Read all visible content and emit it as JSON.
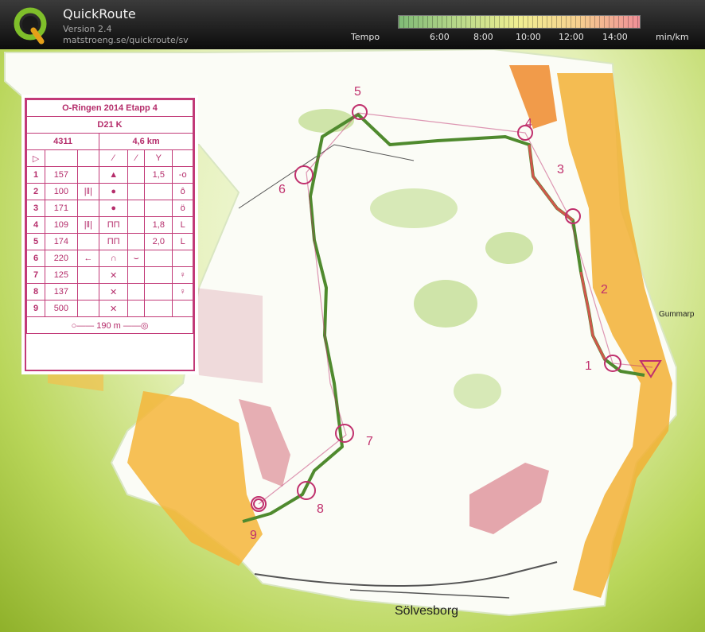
{
  "app": {
    "title": "QuickRoute",
    "version": "Version 2.4",
    "url": "matstroeng.se/quickroute/sv"
  },
  "tempo": {
    "label": "Tempo",
    "ticks": [
      "6:00",
      "8:00",
      "10:00",
      "12:00",
      "14:00"
    ],
    "unit": "min/km",
    "colors": [
      "#7fba76",
      "#f1ef92",
      "#ef8f97"
    ]
  },
  "map": {
    "town_label": "Sölvesborg",
    "place_label": "Gummarp",
    "control_numbers": [
      "1",
      "2",
      "3",
      "4",
      "5",
      "6",
      "7",
      "8",
      "9"
    ],
    "route_color": "#4f8a2e",
    "control_color": "#c0306d"
  },
  "card": {
    "title": "O-Ringen 2014 Etapp 4",
    "class": "D21 K",
    "code": "4311",
    "length": "4,6 km",
    "rows": [
      {
        "n": "1",
        "code": "157",
        "c3": "▲",
        "c4": "1,5",
        "c5": "-o"
      },
      {
        "n": "2",
        "code": "100",
        "c2": "|‖|",
        "c3": "●",
        "c4": "",
        "c5": "ô"
      },
      {
        "n": "3",
        "code": "171",
        "c3": "●",
        "c4": "",
        "c5": "ö"
      },
      {
        "n": "4",
        "code": "109",
        "c2": "|‖|",
        "c3": "ΠΠ",
        "c4": "1,8",
        "c5": "L"
      },
      {
        "n": "5",
        "code": "174",
        "c3": "ΠΠ",
        "c4": "2,0",
        "c5": "L"
      },
      {
        "n": "6",
        "code": "220",
        "c2": "←",
        "c3": "∩",
        "c4": "⌣",
        "c5": ""
      },
      {
        "n": "7",
        "code": "125",
        "c3": "✕",
        "c4": "",
        "c5": "♀"
      },
      {
        "n": "8",
        "code": "137",
        "c3": "✕",
        "c4": "",
        "c5": "♀"
      },
      {
        "n": "9",
        "code": "500",
        "c3": "✕",
        "c4": "",
        "c5": ""
      }
    ],
    "finish": "190 m"
  }
}
